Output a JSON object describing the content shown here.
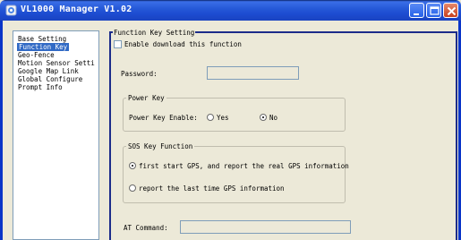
{
  "window": {
    "title": "VL1000 Manager V1.02"
  },
  "nav": {
    "items": [
      {
        "label": "Base Setting"
      },
      {
        "label": "Function Key"
      },
      {
        "label": "Geo-Fence"
      },
      {
        "label": "Motion Sensor Setti"
      },
      {
        "label": "Google Map Link"
      },
      {
        "label": "Global Configure"
      },
      {
        "label": "Prompt Info"
      }
    ],
    "selected": "Function Key"
  },
  "function_key": {
    "group_title": "Function Key Setting",
    "enable_download_label": "Enable download this function",
    "enable_download_checked": false,
    "password_label": "Password:",
    "password_value": "",
    "power_key": {
      "legend": "Power Key",
      "enable_label": "Power Key Enable:",
      "yes_label": "Yes",
      "no_label": "No",
      "selected": "No"
    },
    "sos_key": {
      "legend": "SOS Key Function",
      "option1_label": "first start GPS, and report the real GPS information",
      "option2_label": "report the last time GPS information",
      "selected": "option1"
    },
    "at_command_label": "AT Command:",
    "at_command_value": ""
  }
}
